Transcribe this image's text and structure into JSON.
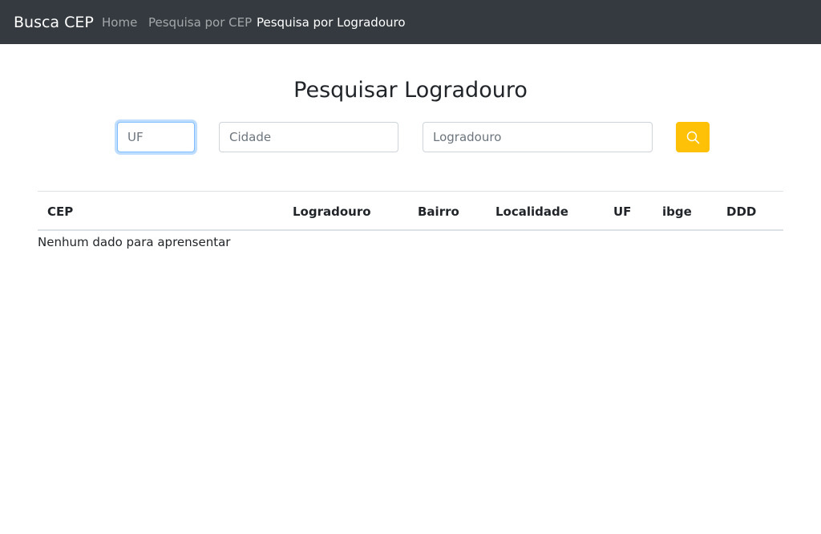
{
  "navbar": {
    "brand": "Busca CEP",
    "links": [
      {
        "label": "Home",
        "active": false
      },
      {
        "label": "Pesquisa por CEP",
        "active": false
      },
      {
        "label": "Pesquisa por Logradouro",
        "active": true
      }
    ]
  },
  "page": {
    "title": "Pesquisar Logradouro"
  },
  "form": {
    "uf": {
      "value": "",
      "placeholder": "UF"
    },
    "cidade": {
      "value": "",
      "placeholder": "Cidade"
    },
    "logradouro": {
      "value": "",
      "placeholder": "Logradouro"
    },
    "search_button_icon": "search-icon"
  },
  "table": {
    "columns": [
      "CEP",
      "Logradouro",
      "Bairro",
      "Localidade",
      "UF",
      "ibge",
      "DDD"
    ],
    "rows": [],
    "empty_message": "Nenhum dado para aprensentar"
  },
  "colors": {
    "navbar_bg": "#343a40",
    "accent_button": "#ffc107",
    "focus_ring": "#80bdff"
  }
}
